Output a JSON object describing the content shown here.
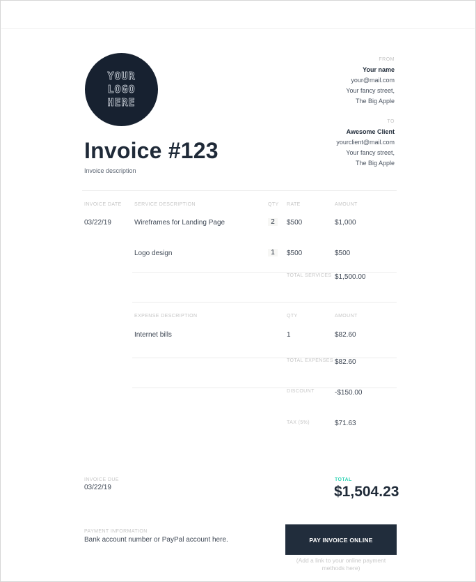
{
  "logo": {
    "lines": [
      "YOUR",
      "LOGO",
      "HERE"
    ]
  },
  "header": {
    "title": "Invoice #123",
    "description": "Invoice description"
  },
  "from": {
    "label": "FROM",
    "name": "Your name",
    "email": "your@mail.com",
    "street": "Your fancy street,",
    "city": "The Big Apple"
  },
  "to": {
    "label": "TO",
    "name": "Awesome Client",
    "email": "yourclient@mail.com",
    "street": "Your fancy street,",
    "city": "The Big Apple"
  },
  "services": {
    "headers": {
      "date": "INVOICE DATE",
      "description": "SERVICE DESCRIPTION",
      "qty": "QTY",
      "rate": "RATE",
      "amount": "AMOUNT"
    },
    "invoice_date": "03/22/19",
    "rows": [
      {
        "description": "Wireframes for Landing Page",
        "qty": "2",
        "rate": "$500",
        "amount": "$1,000"
      },
      {
        "description": "Logo design",
        "qty": "1",
        "rate": "$500",
        "amount": "$500"
      }
    ],
    "total_label": "TOTAL SERVICES",
    "total_value": "$1,500.00"
  },
  "expenses": {
    "headers": {
      "description": "EXPENSE DESCRIPTION",
      "qty": "QTY",
      "amount": "AMOUNT"
    },
    "rows": [
      {
        "description": "Internet bills",
        "qty": "1",
        "amount": "$82.60"
      }
    ],
    "total_label": "TOTAL EXPENSES",
    "total_value": "$82.60"
  },
  "adjustments": {
    "discount_label": "DISCOUNT",
    "discount_value": "-$150.00",
    "tax_label": "TAX (5%)",
    "tax_value": "$71.63"
  },
  "due": {
    "label": "INVOICE DUE",
    "value": "03/22/19"
  },
  "total": {
    "label": "TOTAL",
    "value": "$1,504.23",
    "accent": "#33d4b5"
  },
  "payment": {
    "label": "PAYMENT INFORMATION",
    "text": "Bank account number or PayPal account here.",
    "button_label": "PAY INVOICE ONLINE",
    "note": "(Add a link to your online payment methods here)"
  }
}
